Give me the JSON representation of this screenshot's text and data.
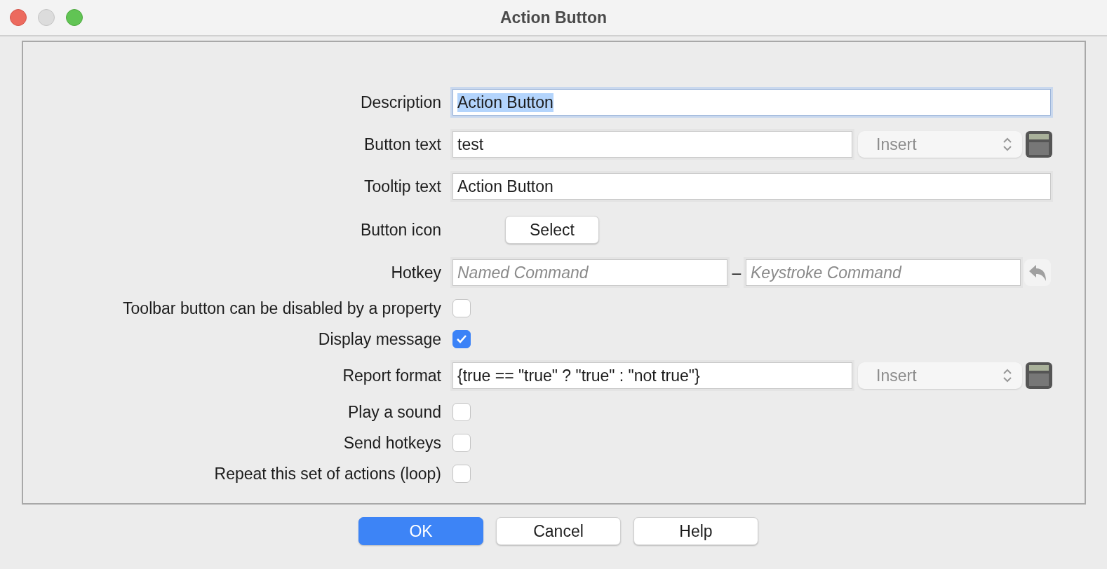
{
  "window": {
    "title": "Action Button"
  },
  "rows": [
    {
      "kind": "text",
      "label": "Description",
      "value": "Action Button",
      "focused": true
    },
    {
      "kind": "insert",
      "label": "Button text",
      "value": "test",
      "select": "Insert"
    },
    {
      "kind": "text",
      "label": "Tooltip text",
      "value": "Action Button",
      "focused": false
    },
    {
      "kind": "button",
      "label": "Button icon",
      "button": "Select"
    },
    {
      "kind": "hotkey",
      "label": "Hotkey",
      "placeholder": "Named Command",
      "separator": "–",
      "placeholder_2": "Keystroke Command"
    },
    {
      "kind": "checkbox",
      "label": "Toolbar button can be disabled by a property",
      "checked": false
    },
    {
      "kind": "checkbox",
      "label": "Display message",
      "checked": true
    },
    {
      "kind": "insert",
      "label": "Report format",
      "value": "{true == \"true\" ? \"true\" : \"not true\"}",
      "select": "Insert"
    },
    {
      "kind": "checkbox",
      "label": "Play a sound",
      "checked": false
    },
    {
      "kind": "checkbox",
      "label": "Send hotkeys",
      "checked": false
    },
    {
      "kind": "checkbox",
      "label": "Repeat this set of actions (loop)",
      "checked": false
    }
  ],
  "buttons": [
    {
      "label": "OK",
      "default": true
    },
    {
      "label": "Cancel",
      "default": false
    },
    {
      "label": "Help",
      "default": false
    }
  ]
}
